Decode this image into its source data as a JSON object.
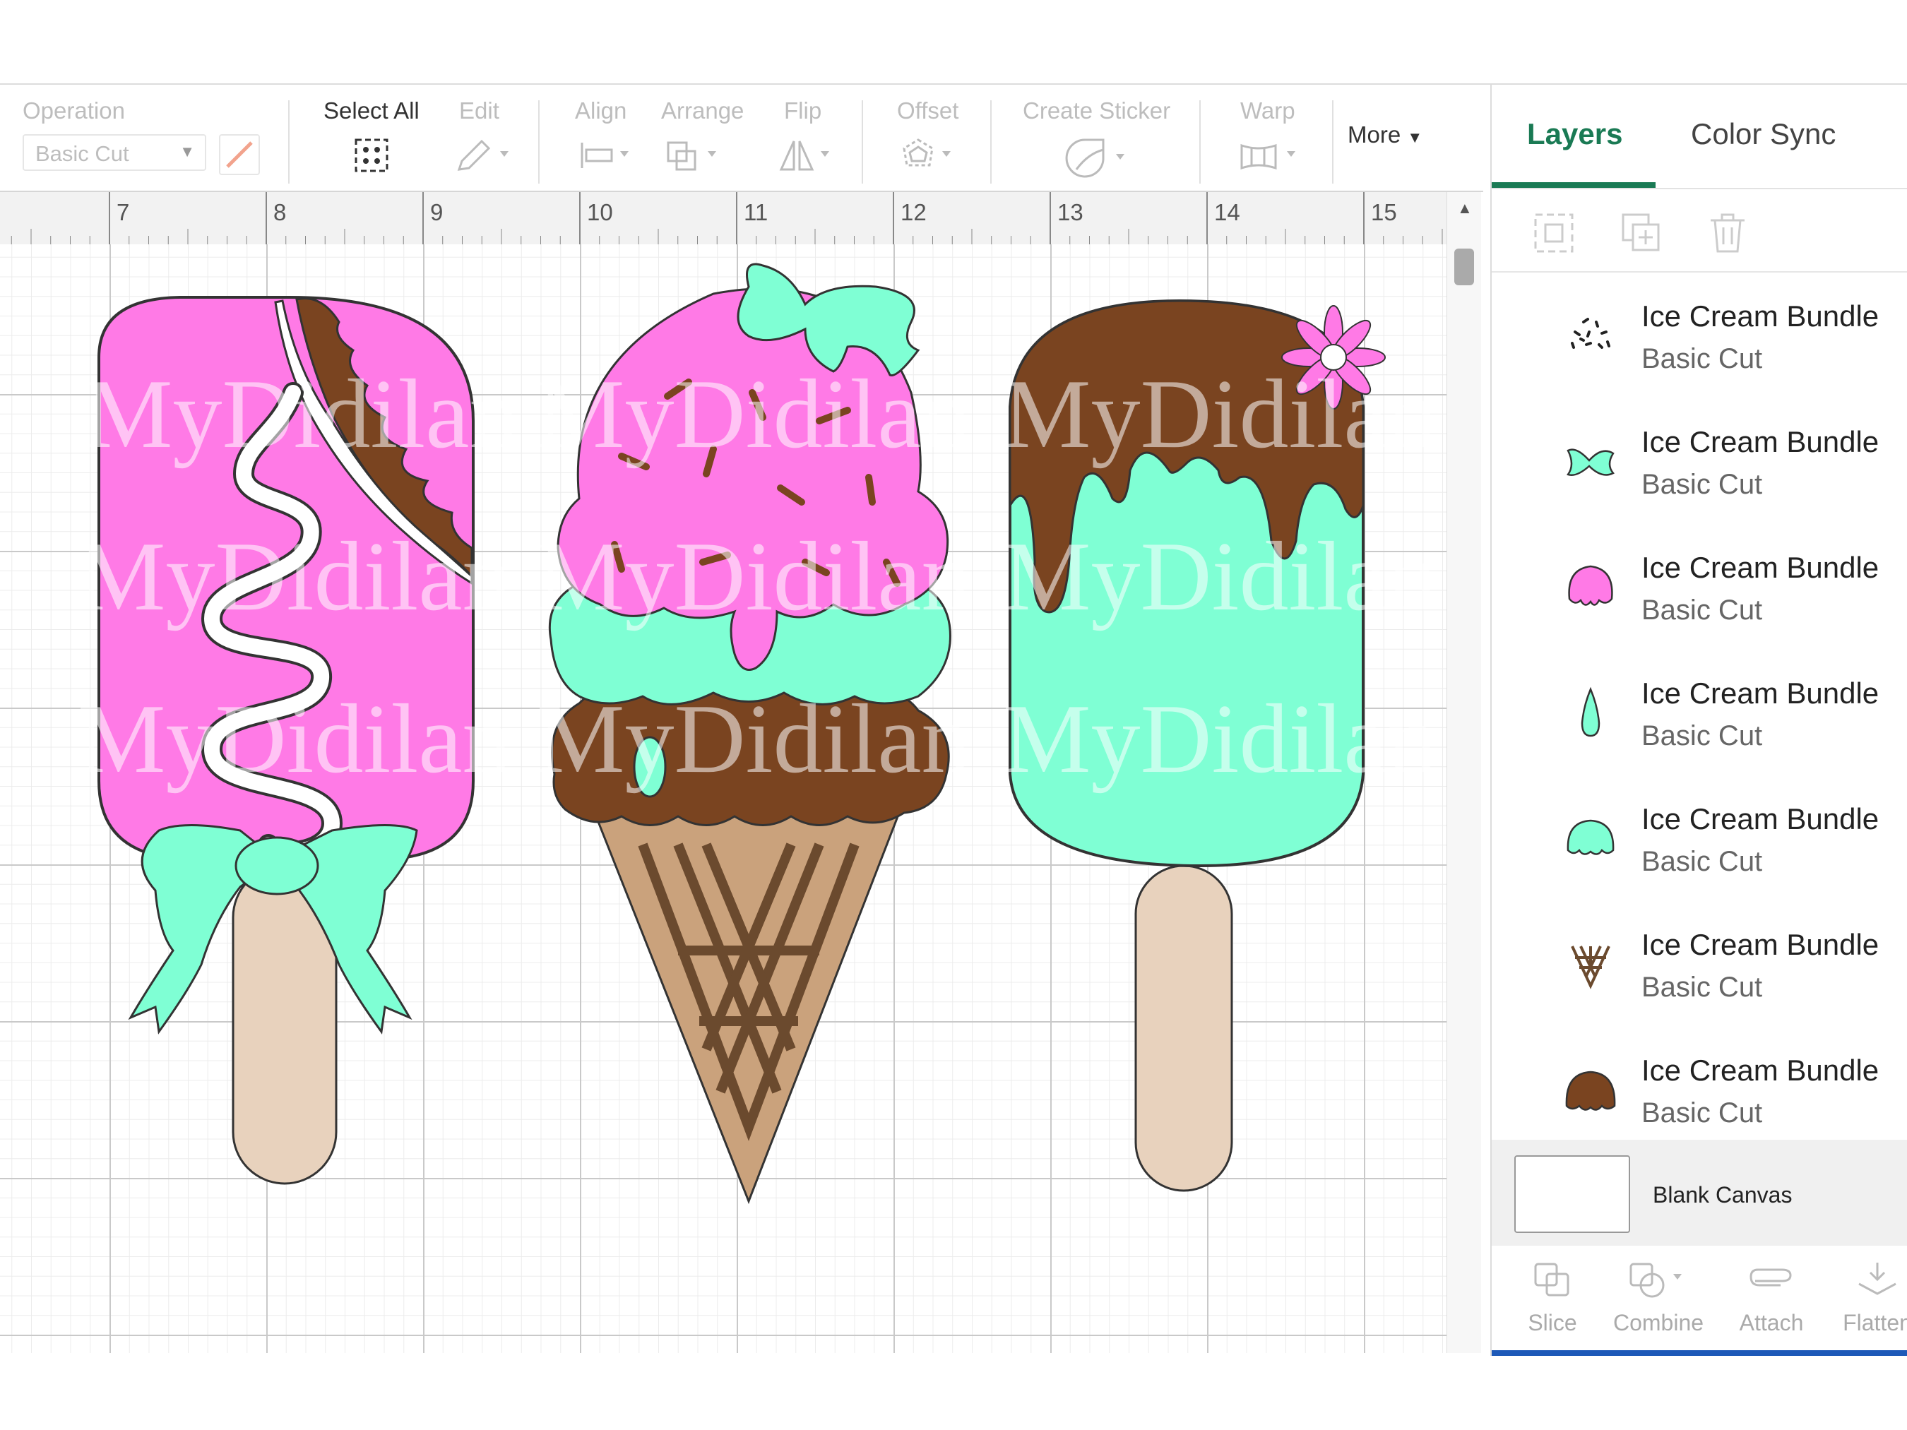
{
  "toolbar": {
    "operation_label": "Operation",
    "operation_value": "Basic Cut",
    "select_all_label": "Select All",
    "edit_label": "Edit",
    "align_label": "Align",
    "arrange_label": "Arrange",
    "flip_label": "Flip",
    "offset_label": "Offset",
    "create_sticker_label": "Create Sticker",
    "warp_label": "Warp",
    "more_label": "More"
  },
  "ruler": {
    "numbers": [
      "7",
      "8",
      "9",
      "10",
      "11",
      "12",
      "13",
      "14",
      "15"
    ]
  },
  "canvas": {
    "watermark": "MyDidilan"
  },
  "panel": {
    "tabs": [
      "Layers",
      "Color Sync"
    ],
    "active_tab": "Layers",
    "layers": [
      {
        "name": "Ice Cream Bundle",
        "operation": "Basic Cut",
        "icon": "sprinkles-icon",
        "color": "#222222"
      },
      {
        "name": "Ice Cream Bundle",
        "operation": "Basic Cut",
        "icon": "bow-icon",
        "color": "#7fffd4"
      },
      {
        "name": "Ice Cream Bundle",
        "operation": "Basic Cut",
        "icon": "scoop-icon",
        "color": "#ff7ae6"
      },
      {
        "name": "Ice Cream Bundle",
        "operation": "Basic Cut",
        "icon": "drop-icon",
        "color": "#7fffd4"
      },
      {
        "name": "Ice Cream Bundle",
        "operation": "Basic Cut",
        "icon": "scoop-icon",
        "color": "#7fffd4"
      },
      {
        "name": "Ice Cream Bundle",
        "operation": "Basic Cut",
        "icon": "waffle-icon",
        "color": "#6b4a2e"
      },
      {
        "name": "Ice Cream Bundle",
        "operation": "Basic Cut",
        "icon": "scoop-icon",
        "color": "#7a4420"
      }
    ],
    "blank_canvas_label": "Blank Canvas",
    "bottom_actions": [
      "Slice",
      "Combine",
      "Attach",
      "Flatten"
    ]
  },
  "colors": {
    "pink": "#ff7ae6",
    "mint": "#7fffd4",
    "chocolate": "#7a4420",
    "stick": "#e8d2bd",
    "cone": "#caa27c",
    "accent_green": "#1a7a54",
    "accent_blue": "#1d59b8"
  }
}
